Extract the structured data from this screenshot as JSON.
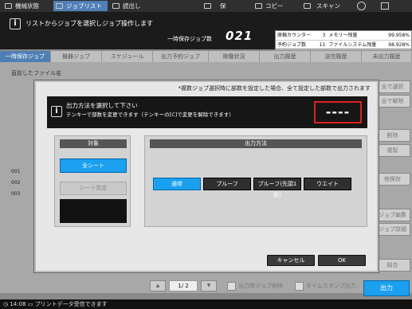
{
  "topbar": {
    "tabs": [
      {
        "label": "機械状態",
        "icon": "machine-status-icon"
      },
      {
        "label": "ジョブリスト",
        "icon": "job-list-icon"
      },
      {
        "label": "読出し",
        "icon": "recall-icon"
      },
      {
        "label": "保存",
        "icon": "save-icon"
      },
      {
        "label": "コピー",
        "icon": "copy-icon"
      },
      {
        "label": "スキャン",
        "icon": "scan-icon"
      }
    ],
    "globe_icon": "globe-icon",
    "settings_icon": "settings-icon"
  },
  "message": {
    "text": "リストからジョブを選択しジョブ操作します",
    "held_jobs_label": "一時保存ジョブ数",
    "held_jobs_count": "021"
  },
  "counters": {
    "rows": [
      {
        "label": "原稿カウンター",
        "value": "3",
        "label2": "メモリー残量",
        "value2": "99.958%"
      },
      {
        "label": "予約ジョブ数",
        "value": "11",
        "label2": "ファイルシステム残量",
        "value2": "98.928%"
      }
    ]
  },
  "job_tabs": [
    "一時保存ジョブ",
    "機器ジョブ",
    "スケジュール",
    "出力予約ジョブ",
    "稼働状況",
    "出力履歴",
    "送信履歴",
    "未出力履歴"
  ],
  "background": {
    "list_header": "直前したファイル名",
    "rows": [
      "001",
      "002",
      "003"
    ],
    "right_buttons": [
      "全で選択",
      "全で解除",
      "削除",
      "複製",
      "他保存",
      "ジョブ編集",
      "ジョブ詳細",
      "結合"
    ],
    "pager": "1/ 2",
    "check1": "出力時ジョブ削除",
    "check2": "タイムスタンプ出力",
    "output_button": "出力"
  },
  "dialog": {
    "caption": "*複数ジョブ選択時に部数を設定した場合、全て設定した部数で出力されます",
    "header_line1": "出力方法を選択して下さい",
    "header_line2": "テンキーで部数を変更できます（テンキーの[C]で変更を解除できます）",
    "copies_display": "----",
    "target_title": "対象",
    "target_all": "全シート",
    "target_spec": "シート指定",
    "method_title": "出力方法",
    "methods": [
      "通常",
      "プルーフ",
      "プルーフ(先頭1枚)",
      "ウエイト"
    ],
    "selected_method": "通常",
    "cancel_label": "キャンセル",
    "ok_label": "OK"
  },
  "status": {
    "time": "14:08",
    "text": "プリントデータ受信できます"
  },
  "colors": {
    "accent_blue": "#1aa0ef",
    "tab_active": "#4f7fb5",
    "alert_red": "#e02020"
  }
}
